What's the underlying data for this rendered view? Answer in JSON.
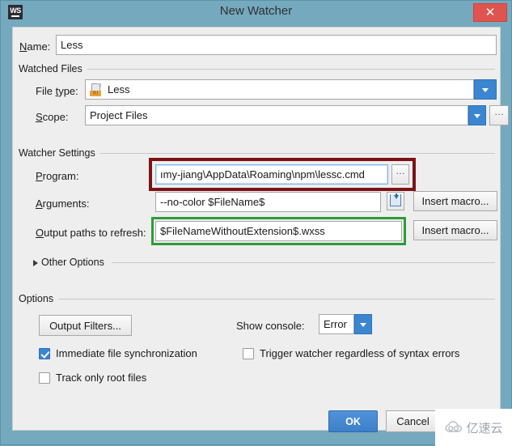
{
  "window": {
    "title": "New Watcher",
    "app_icon": "webstorm-icon",
    "close_label": "✕"
  },
  "name_row": {
    "label_pre": "N",
    "label_post": "ame:",
    "value": "Less"
  },
  "watched_files": {
    "group_title": "Watched Files",
    "file_type": {
      "label_pre": "File ",
      "label_mid": "t",
      "label_post": "ype:",
      "value": "Less",
      "icon": "less-file-icon"
    },
    "scope": {
      "label_pre": "S",
      "label_post": "cope:",
      "value": "Project Files",
      "browse_label": "…"
    }
  },
  "watcher_settings": {
    "group_title": "Watcher Settings",
    "program": {
      "label_pre": "P",
      "label_post": "rogram:",
      "value": "ımy-jiang\\AppData\\Roaming\\npm\\lessc.cmd",
      "browse_label": "…",
      "highlight_color": "#7d1216"
    },
    "arguments": {
      "label_pre": "A",
      "label_post": "rguments:",
      "value": "--no-color $FileName$",
      "insert_macro_label": "Insert macro...",
      "macro_icon": "insert-macro-icon"
    },
    "output_paths": {
      "label_pre": "O",
      "label_post": "utput paths to refresh:",
      "value": "$FileNameWithoutExtension$.wxss",
      "insert_macro_label": "Insert macro...",
      "highlight_color": "#2e9b3a"
    },
    "other_options": {
      "label": "Other Options",
      "expanded": false,
      "chevron": "chevron-right-icon"
    }
  },
  "options": {
    "group_title": "Options",
    "output_filters_label": "Output Filters...",
    "show_console": {
      "label": "Show console:",
      "value": "Error"
    },
    "checkboxes": [
      {
        "label": "Immediate file synchronization",
        "checked": true
      },
      {
        "label": "Trigger watcher regardless of syntax errors",
        "checked": false
      },
      {
        "label": "Track only root files",
        "checked": false
      }
    ]
  },
  "footer": {
    "ok_label": "OK",
    "cancel_label": "Cancel"
  },
  "watermark": {
    "text": "亿速云",
    "icon": "cloud-icon"
  },
  "colors": {
    "window_frame": "#74a9be",
    "dialog_bg": "#eeeeee",
    "accent_blue": "#3b86d1",
    "close_red": "#e0544f",
    "highlight_red": "#7d1216",
    "highlight_green": "#2e9b3a"
  }
}
